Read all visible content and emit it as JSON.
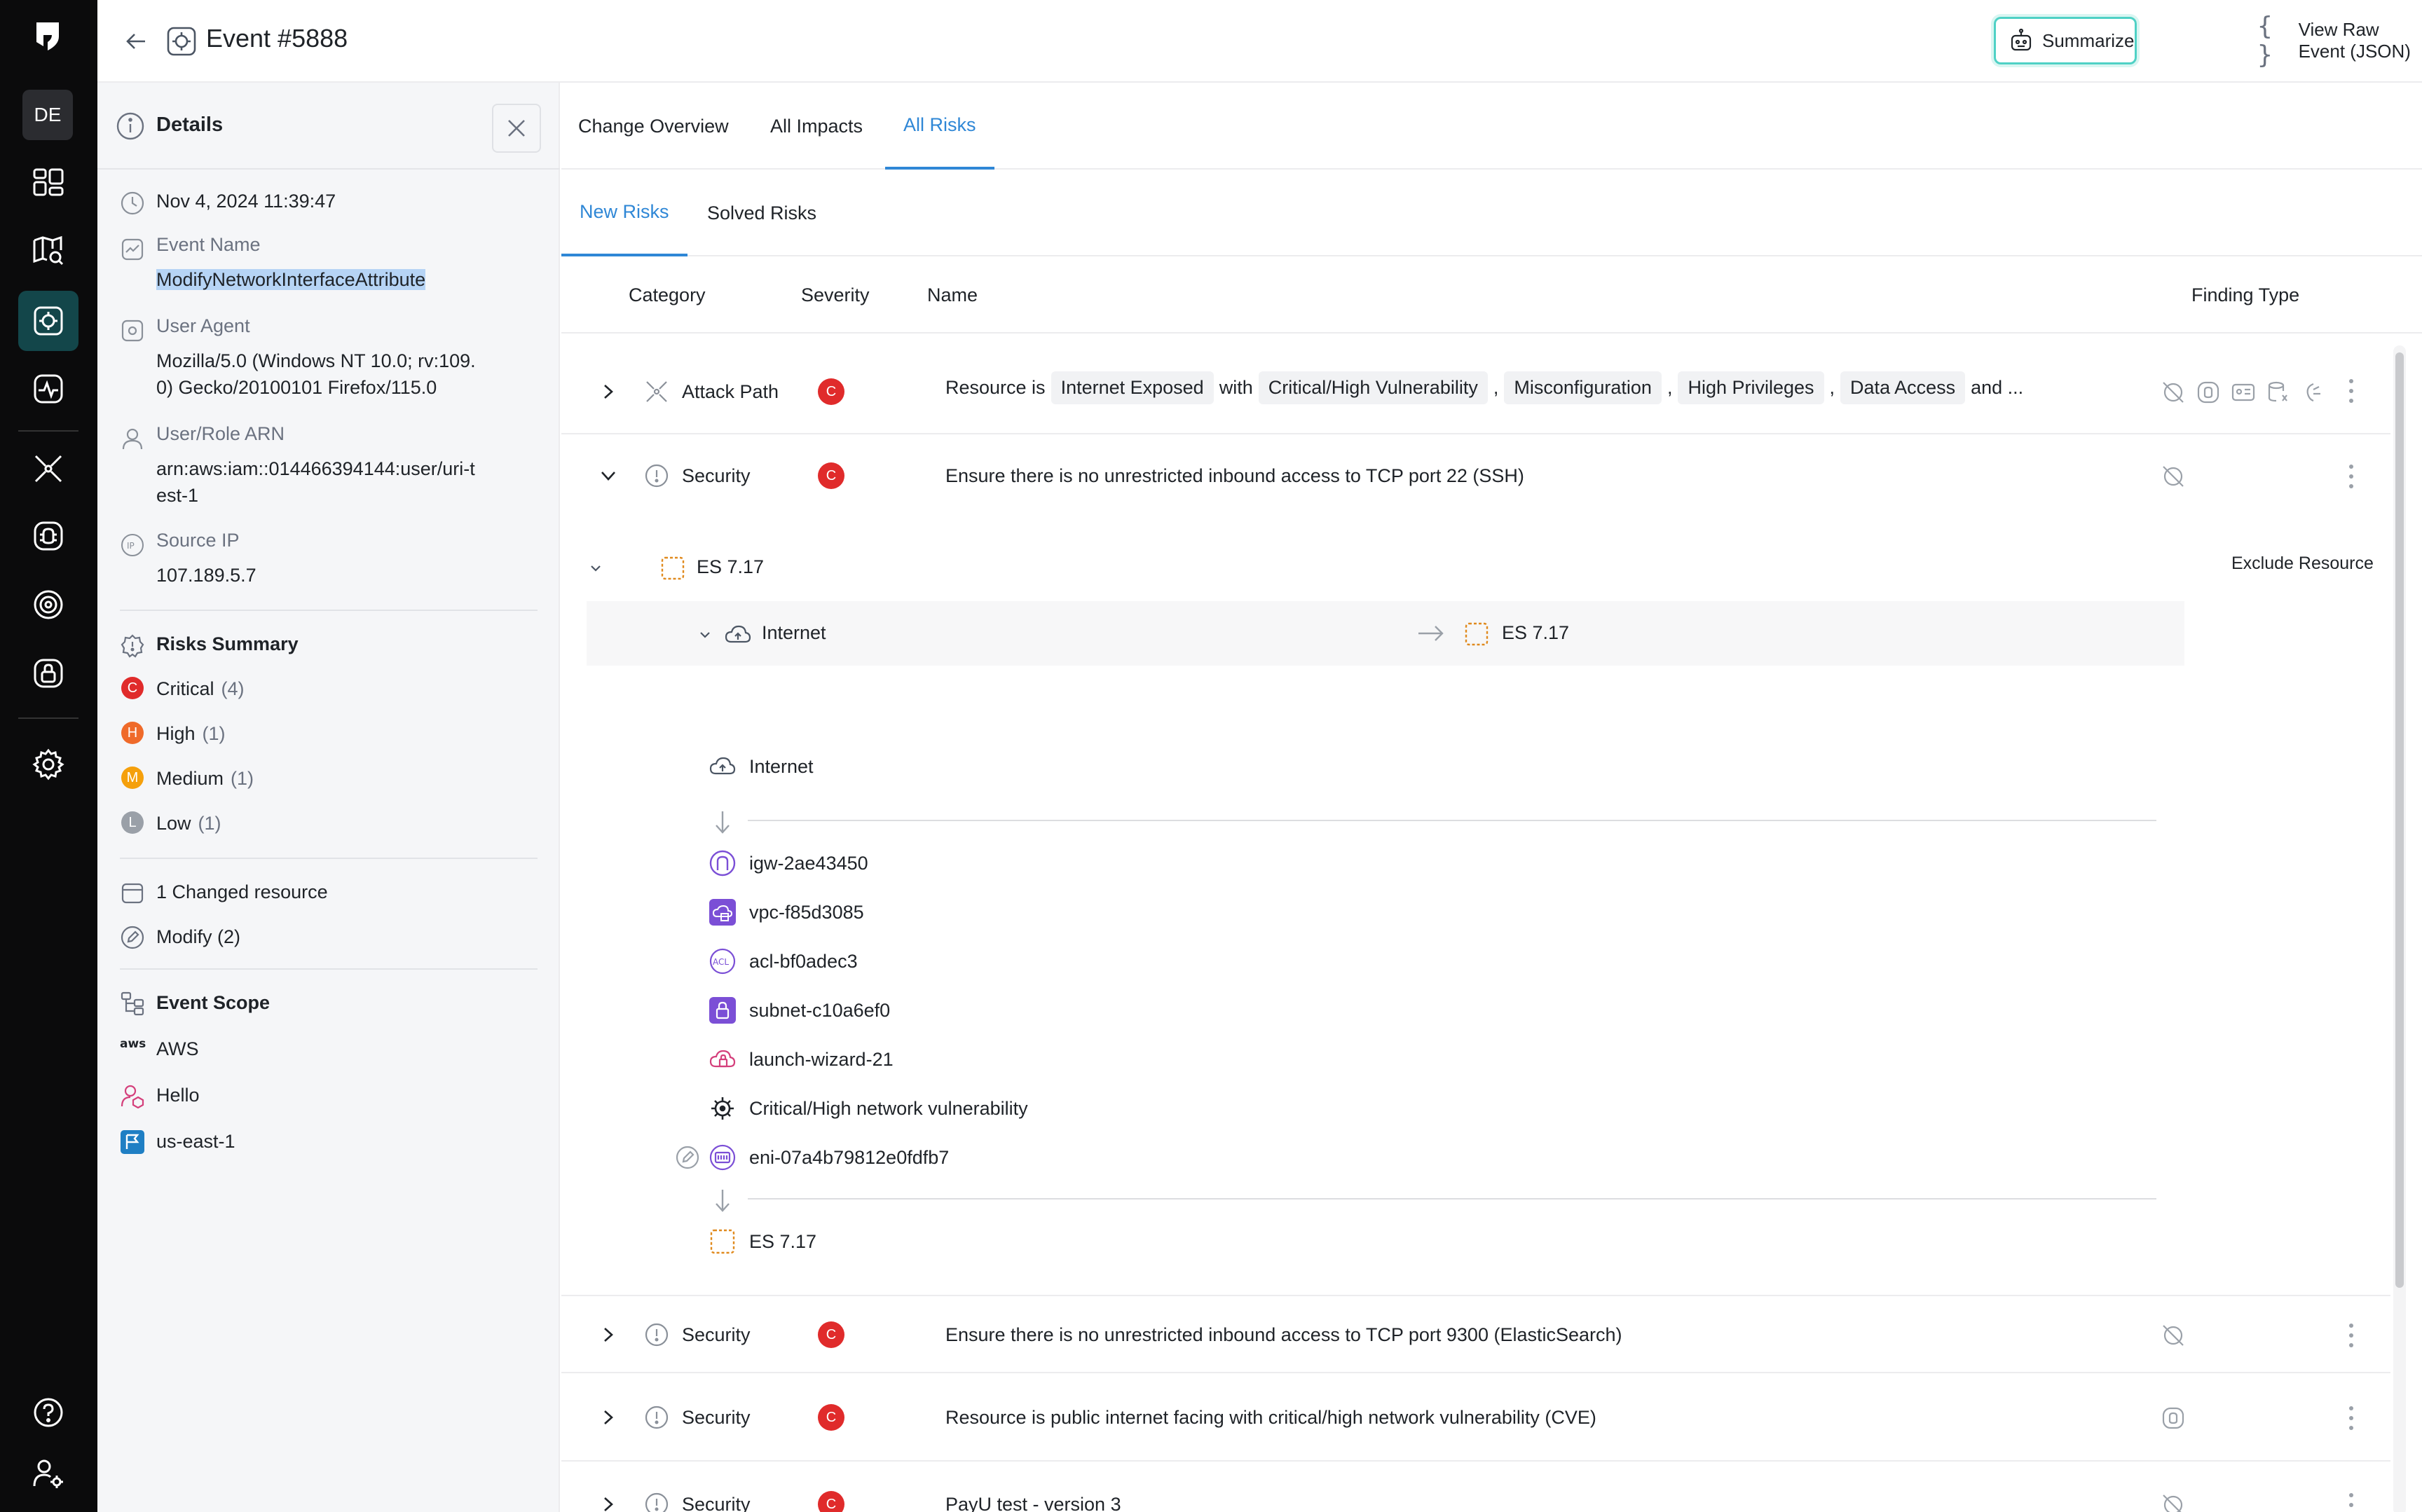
{
  "rail": {
    "avatar": "DE"
  },
  "header": {
    "title": "Event #5888",
    "summarize": "Summarize",
    "raw_json": "View Raw Event (JSON)",
    "raw_json_icon": "{ }"
  },
  "details": {
    "title": "Details",
    "timestamp": "Nov 4, 2024 11:39:47",
    "event_name_label": "Event Name",
    "event_name": "ModifyNetworkInterfaceAttribute",
    "user_agent_label": "User Agent",
    "user_agent_line1": "Mozilla/5.0 (Windows NT 10.0; rv:109.",
    "user_agent_line2": "0) Gecko/20100101 Firefox/115.0",
    "arn_label": "User/Role ARN",
    "arn_line1": "arn:aws:iam::014466394144:user/uri-t",
    "arn_line2": "est-1",
    "source_ip_label": "Source IP",
    "source_ip": "107.189.5.7",
    "risks_summary_label": "Risks Summary",
    "risks": [
      {
        "letter": "C",
        "label": "Critical",
        "count": "(4)",
        "color": "#e02b2b"
      },
      {
        "letter": "H",
        "label": "High",
        "count": "(1)",
        "color": "#ef6a2a"
      },
      {
        "letter": "M",
        "label": "Medium",
        "count": "(1)",
        "color": "#f5a00c"
      },
      {
        "letter": "L",
        "label": "Low",
        "count": "(1)",
        "color": "#9aa0a8"
      }
    ],
    "changed_resource": "1 Changed resource",
    "modify": "Modify (2)",
    "event_scope_label": "Event Scope",
    "scope": {
      "cloud": "AWS",
      "cloud_logo": "aws",
      "account": "Hello",
      "region": "us-east-1"
    }
  },
  "tabs": {
    "overview": "Change Overview",
    "impacts": "All Impacts",
    "risks": "All Risks",
    "new_risks": "New Risks",
    "solved_risks": "Solved Risks"
  },
  "columns": {
    "category": "Category",
    "severity": "Severity",
    "name": "Name",
    "finding_type": "Finding Type"
  },
  "rows": [
    {
      "category": "Attack Path",
      "severity": "C",
      "name_prefix": "Resource is",
      "chips": [
        "Internet Exposed",
        "Critical/High Vulnerability",
        "Misconfiguration",
        "High Privileges",
        "Data Access"
      ],
      "connectors": [
        "with",
        ",",
        ",",
        ",",
        "and ..."
      ]
    },
    {
      "category": "Security",
      "severity": "C",
      "name": "Ensure there is no unrestricted inbound access to TCP port 22 (SSH)"
    },
    {
      "category": "Security",
      "severity": "C",
      "name": "Ensure there is no unrestricted inbound access to TCP port 9300 (ElasticSearch)"
    },
    {
      "category": "Security",
      "severity": "C",
      "name": "Resource is public internet facing with critical/high network vulnerability (CVE)"
    },
    {
      "category": "Security",
      "severity": "C",
      "name": "PayU test - version 3"
    }
  ],
  "expanded": {
    "resource": "ES 7.17",
    "exclude": "Exclude Resource",
    "path_from": "Internet",
    "path_to": "ES 7.17",
    "steps": [
      {
        "label": "Internet",
        "icon": "cloud-icon"
      },
      {
        "label": "igw-2ae43450",
        "icon": "internet-gateway-icon"
      },
      {
        "label": "vpc-f85d3085",
        "icon": "vpc-icon"
      },
      {
        "label": "acl-bf0adec3",
        "icon": "acl-icon"
      },
      {
        "label": "subnet-c10a6ef0",
        "icon": "subnet-icon"
      },
      {
        "label": "launch-wizard-21",
        "icon": "security-group-icon"
      },
      {
        "label": "Critical/High network vulnerability",
        "icon": "vulnerability-icon"
      },
      {
        "label": "eni-07a4b79812e0fdfb7",
        "icon": "eni-icon"
      },
      {
        "label": "ES 7.17",
        "icon": "chip-icon"
      }
    ]
  },
  "colors": {
    "accent": "#2f87d6",
    "rail_active": "#13464a",
    "critical": "#e02b2b",
    "summarize_border": "#4fd1c5",
    "chip_orange": "#e08a1e",
    "purple": "#7b4fd6"
  }
}
